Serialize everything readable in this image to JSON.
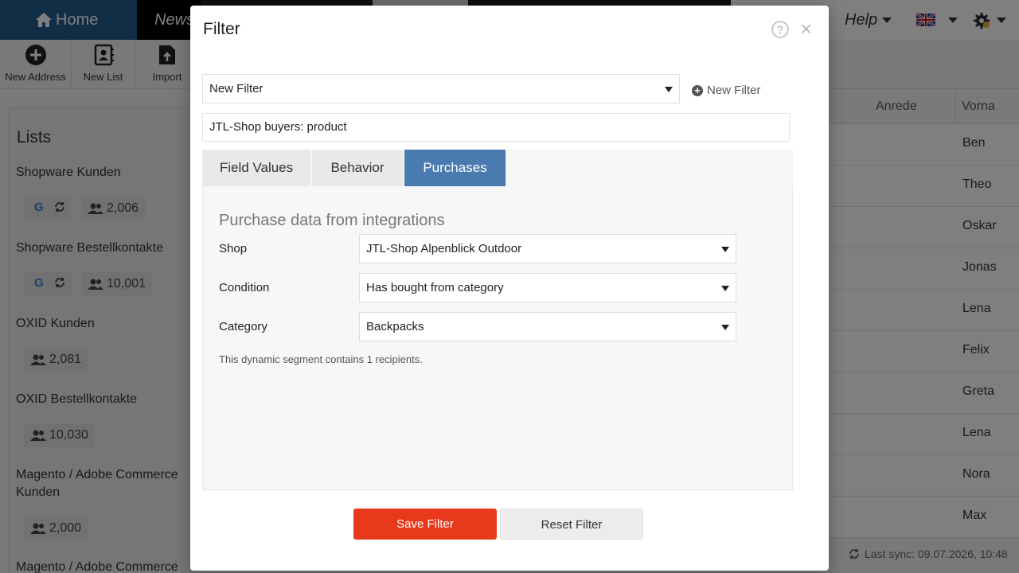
{
  "nav": {
    "home": "Home",
    "news": "News",
    "help": "Help"
  },
  "toolbar": {
    "new_address": "New Address",
    "new_list": "New List",
    "import": "Import"
  },
  "lists": {
    "title": "Lists",
    "items": [
      {
        "name": "Shopware Kunden",
        "count": "2,006"
      },
      {
        "name": "Shopware Bestellkontakte",
        "count": "10,001"
      },
      {
        "name": "OXID Kunden",
        "count": "2,081"
      },
      {
        "name": "OXID Bestellkontakte",
        "count": "10,030"
      },
      {
        "name": "Magento / Adobe Commerce Kunden",
        "count": "2,000"
      },
      {
        "name": "Magento / Adobe Commerce",
        "count": ""
      }
    ]
  },
  "table": {
    "headers": [
      "Anrede",
      "Vorna"
    ],
    "first_names": [
      "Ben",
      "Theo",
      "Oskar",
      "Jonas",
      "Lena",
      "Felix",
      "Greta",
      "Lena",
      "Nora",
      "Max"
    ]
  },
  "last_sync": "Last sync: 09.07.2026, 10:48",
  "modal": {
    "title": "Filter",
    "help_glyph": "?",
    "close_glyph": "×",
    "filter_select": "New Filter",
    "new_filter": "New Filter",
    "filter_name": "JTL-Shop buyers: product",
    "tabs": [
      "Field Values",
      "Behavior",
      "Purchases"
    ],
    "active_tab": "Purchases",
    "section_title": "Purchase data from integrations",
    "fields": {
      "shop_label": "Shop",
      "shop_value": "JTL-Shop Alpenblick Outdoor",
      "condition_label": "Condition",
      "condition_value": "Has bought from category",
      "category_label": "Category",
      "category_value": "Backpacks"
    },
    "segment_info": "This dynamic segment contains 1 recipients.",
    "save_label": "Save Filter",
    "reset_label": "Reset Filter"
  },
  "colors": {
    "accent": "#4a7bb0",
    "save": "#e8391d",
    "nav_home": "#245b8c"
  }
}
